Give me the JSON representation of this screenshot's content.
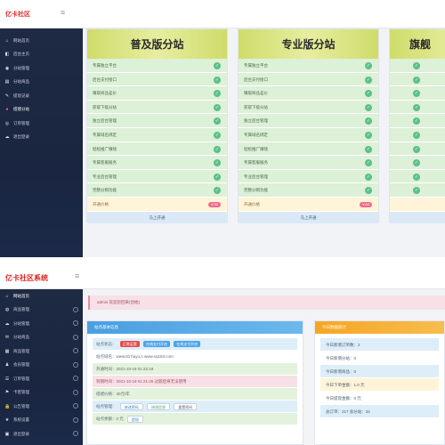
{
  "screen1": {
    "logo": "亿卡社区",
    "sidebar": [
      {
        "icon": "⌂",
        "label": "网站首页"
      },
      {
        "icon": "◧",
        "label": "后台主页"
      },
      {
        "icon": "◉",
        "label": "分站管理"
      },
      {
        "icon": "▤",
        "label": "分站商品"
      },
      {
        "icon": "✎",
        "label": "提现记录"
      },
      {
        "icon": "●",
        "label": "搭建分站"
      },
      {
        "icon": "◎",
        "label": "订单管理"
      },
      {
        "icon": "☁",
        "label": "退出登录"
      }
    ],
    "packages": [
      {
        "title": "普及版分站",
        "features": [
          "专属独立平台",
          "后台支付接口",
          "赚取商品差价",
          "获取下级分站",
          "独立后台管理",
          "专属域名绑定",
          "轻松推广赚钱",
          "专属客服服务",
          "专业后台管理",
          "完整分销功能"
        ],
        "price_label": "开通价格",
        "price": "¥ 30",
        "button": "马上开通"
      },
      {
        "title": "专业版分站",
        "features": [
          "专属独立平台",
          "后台支付接口",
          "赚取商品差价",
          "获取下级分站",
          "独立后台管理",
          "专属域名绑定",
          "轻松推广赚钱",
          "专属客服服务",
          "专业后台管理",
          "完整分销功能"
        ],
        "price_label": "开通价格",
        "price": "¥ 60",
        "button": "马上开通"
      },
      {
        "title": "旗舰",
        "features": [
          "",
          "",
          "",
          "",
          "",
          "",
          "",
          "",
          "",
          ""
        ],
        "price_label": "",
        "price": "",
        "button": ""
      }
    ]
  },
  "screen2": {
    "logo": "亿卡社区系统",
    "sidebar": [
      {
        "icon": "⌂",
        "label": "网站首页"
      },
      {
        "icon": "◍",
        "label": "商品管理"
      },
      {
        "icon": "☁",
        "label": "分站管理"
      },
      {
        "icon": "✉",
        "label": "分站商品"
      },
      {
        "icon": "▦",
        "label": "商品管理"
      },
      {
        "icon": "♟",
        "label": "会员管理"
      },
      {
        "icon": "☰",
        "label": "订单管理"
      },
      {
        "icon": "⚑",
        "label": "卡密管理"
      },
      {
        "icon": "🔒",
        "label": "公告管理"
      },
      {
        "icon": "★",
        "label": "系统设置"
      },
      {
        "icon": "▣",
        "label": "退出登录"
      }
    ],
    "notice": "admin 欢迎您回来(创始)",
    "left_panel": {
      "title": "站点基本信息",
      "rows": [
        {
          "label": "站点状态：",
          "chips": [
            {
              "text": "正常运营",
              "color": "#e54b4b"
            },
            {
              "text": "在线支付开启",
              "color": "#4aa3e8"
            },
            {
              "text": "在线支付开启",
              "color": "#4aa3e8"
            }
          ]
        },
        {
          "label": "站点域名：",
          "value": "www.817iuyu.n www.sq183.com"
        },
        {
          "label": "开通时间：",
          "value": "2021-10-18 01:22:18"
        },
        {
          "label": "到期时间：",
          "value": "2031-10-18 01:21:45 过期后将无法使用"
        },
        {
          "label": "搭建价格：",
          "value": "30元/年"
        },
        {
          "label": "站点管理：",
          "buttons": [
            "修改密码",
            "修改信息",
            "重置密码"
          ]
        },
        {
          "label": "站点余额：",
          "value": "0 元",
          "button": "提现"
        }
      ]
    },
    "right_panel": {
      "title": "今日数据统计",
      "rows": [
        "今日新增订单数：2",
        "今日新增分站：0",
        "今日新增商品：0",
        "今日下单金额：1.0 元",
        "今日提现金额：0 元",
        "总订单：217  总分站：34"
      ]
    }
  }
}
